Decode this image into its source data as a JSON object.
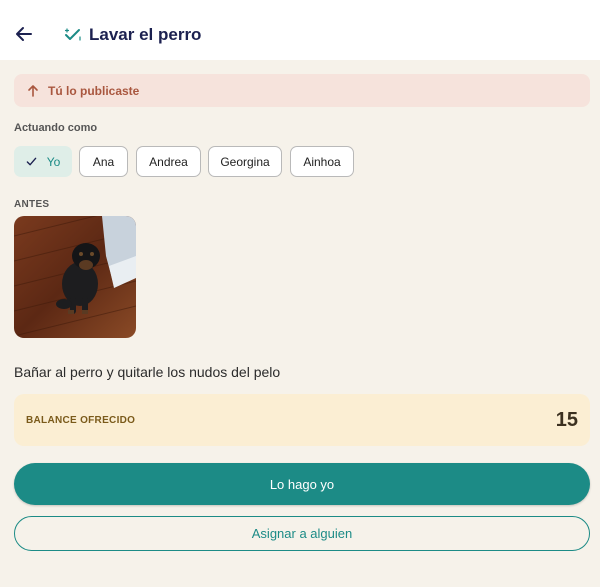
{
  "header": {
    "title": "Lavar el perro",
    "back_icon": "arrow-left-icon",
    "title_icon": "sparkle-check-icon"
  },
  "banner": {
    "text": "Tú lo publicaste",
    "icon": "arrow-up-icon",
    "color": "#a9573f",
    "background": "#f6e3dc"
  },
  "acting_as": {
    "label": "Actuando como",
    "selected": "Yo",
    "options": [
      "Yo",
      "Ana",
      "Andrea",
      "Georgina",
      "Ainhoa"
    ]
  },
  "before": {
    "label": "ANTES",
    "photo": "dog-photo"
  },
  "description": "Bañar al perro y quitarle los nudos del pelo",
  "balance": {
    "label": "BALANCE OFRECIDO",
    "value": "15"
  },
  "actions": {
    "primary_label": "Lo hago yo",
    "secondary_label": "Asignar a alguien"
  },
  "colors": {
    "accent": "#1c8b86",
    "background": "#f6f2ea",
    "title": "#1c2150"
  }
}
